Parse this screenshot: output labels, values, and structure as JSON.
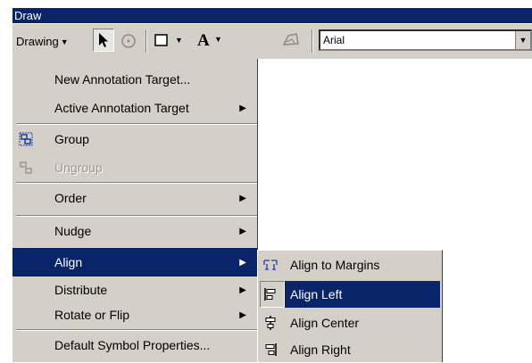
{
  "window": {
    "title": "Draw"
  },
  "toolbar": {
    "drawing_label": "Drawing",
    "font_name": "Arial",
    "icons": [
      "select-arrow-icon",
      "rotate-icon",
      "rectangle-icon",
      "text-A-icon",
      "edit-vertices-icon"
    ]
  },
  "menu": {
    "items": [
      {
        "label": "New Annotation Target..."
      },
      {
        "label": "Active Annotation Target"
      },
      {
        "label": "Group"
      },
      {
        "label": "Ungroup"
      },
      {
        "label": "Order"
      },
      {
        "label": "Nudge"
      },
      {
        "label": "Align"
      },
      {
        "label": "Distribute"
      },
      {
        "label": "Rotate or Flip"
      },
      {
        "label": "Default Symbol Properties..."
      }
    ]
  },
  "submenu": {
    "items": [
      {
        "label": "Align to Margins"
      },
      {
        "label": "Align Left"
      },
      {
        "label": "Align Center"
      },
      {
        "label": "Align Right"
      }
    ]
  },
  "colors": {
    "highlight": "#0a246a",
    "face": "#d4d0c8"
  }
}
